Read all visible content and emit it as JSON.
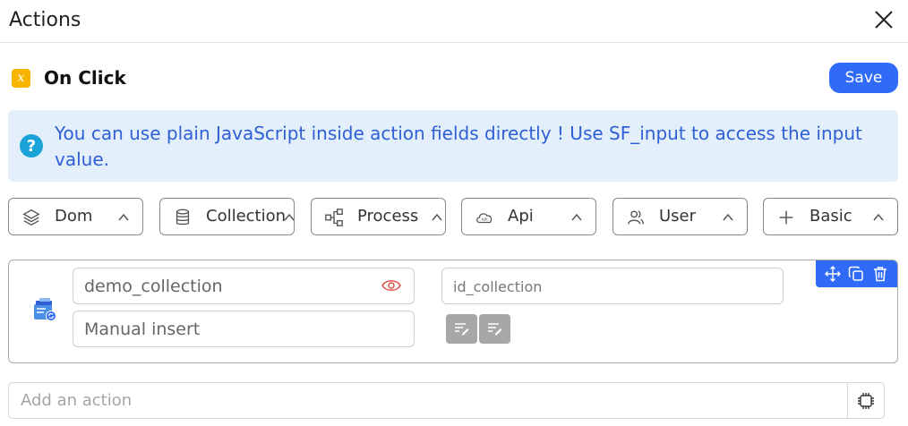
{
  "header": {
    "title": "Actions"
  },
  "event": {
    "icon_glyph": "x",
    "label": "On Click"
  },
  "toolbar": {
    "save_label": "Save"
  },
  "info": {
    "icon_glyph": "?",
    "text": "You can use plain JavaScript inside action fields directly ! Use SF_input to access the input value."
  },
  "categories": [
    {
      "label": "Dom",
      "icon": "layers-icon"
    },
    {
      "label": "Collection",
      "icon": "database-icon"
    },
    {
      "label": "Process",
      "icon": "flow-icon"
    },
    {
      "label": "Api",
      "icon": "cloud-api-icon"
    },
    {
      "label": "User",
      "icon": "users-icon"
    },
    {
      "label": "Basic",
      "icon": "plus-icon"
    }
  ],
  "action": {
    "collection_value": "demo_collection",
    "mode_value": "Manual insert",
    "id_placeholder": "id_collection"
  },
  "add_action": {
    "placeholder": "Add an action"
  },
  "colors": {
    "accent": "#2f6bf6",
    "info_bg": "#e3effa",
    "info_text": "#2f5fd6",
    "event_badge": "#f7b500",
    "eye": "#e0504a"
  }
}
